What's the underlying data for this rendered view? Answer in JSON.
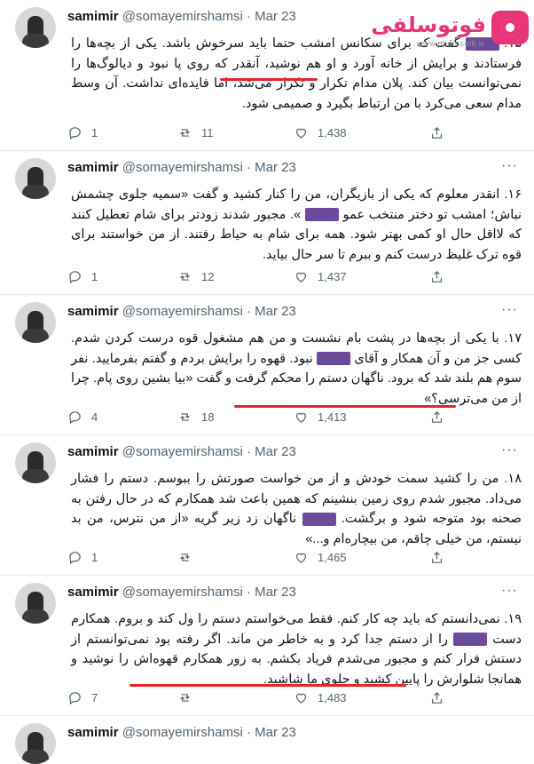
{
  "watermark": {
    "brand": "فوتوسلفی",
    "url": "www.photoselfi.ir"
  },
  "tweets": [
    {
      "name": "samimir",
      "handle": "@somayemirshamsi",
      "date": "Mar 23",
      "text_before": "۱۵.",
      "text": "گفت که برای سکانس امشب حتما باید سرخوش باشد. یکی از بچه‌ها را فرستادند و برایش از خانه آورد و او هم نوشید، آنقدر که روی پا نبود و دیالوگ‌ها را نمی‌توانست بیان کند. پلان مدام تکرار و تکرار می‌شد، اما فایده‌ای نداشت. آن وسط مدام سعی می‌کرد با من ارتباط بگیرد و صمیمی شود.",
      "replies": "1",
      "retweets": "11",
      "likes": "1,438"
    },
    {
      "name": "samimir",
      "handle": "@somayemirshamsi",
      "date": "Mar 23",
      "text_before": "۱۶. انقدر معلوم که یکی از بازیگران، من را کنار کشید و گفت «سمیه جلوی چشمش نباش؛ امشب تو دختر منتخب عمو",
      "text": "». مجبور شدند زودتر برای شام تعطیل کنند که لااقل حال او کمی بهتر شود. همه برای شام به حیاط رفتند. از من خواستند برای قوه ترک غلیظ درست کنم و ببرم تا سر حال بیاید.",
      "replies": "1",
      "retweets": "12",
      "likes": "1,437"
    },
    {
      "name": "samimir",
      "handle": "@somayemirshamsi",
      "date": "Mar 23",
      "text_before": "۱۷. با یکی از بچه‌ها در پشت بام نشست و من هم مشغول قوه درست کردن شدم. کسی جز من و آن همکار و آقای",
      "text": "نبود. قهوه را برایش بردم و گفتم بفرمایید. نفر سوم هم بلند شد که برود. ناگهان دستم را محکم گرفت و گفت «بیا بشین روی پام. چرا از من می‌ترسی؟»",
      "replies": "4",
      "retweets": "18",
      "likes": "1,413"
    },
    {
      "name": "samimir",
      "handle": "@somayemirshamsi",
      "date": "Mar 23",
      "text_before": "۱۸. من را کشید سمت خودش و از من خواست صورتش را ببوسم. دستم را فشار می‌داد. مجبور شدم روی زمین بنشینم که همین باعث شد همکارم که در حال رفتن به صحنه بود متوجه شود و برگشت.",
      "text": "ناگهان زد زیر گریه «از من نترس، من بد نیستم، من خیلی چاقم، من بیچاره‌ام و...»",
      "replies": "1",
      "retweets": "",
      "likes": "1,465"
    },
    {
      "name": "samimir",
      "handle": "@somayemirshamsi",
      "date": "Mar 23",
      "text_before": "۱۹. نمی‌دانستم که باید چه کار کنم. فقط می‌خواستم دستم را ول کند و بروم. همکارم دست",
      "text": "را از دستم جدا کرد و به خاطر من ماند. اگر رفته بود نمی‌توانستم از دستش فرار کنم و مجبور می‌شدم فریاد بکشم. به زور همکارم قهوه‌اش را نوشید و همانجا شلوارش را پایین کشید و جلوی ما شاشید.",
      "replies": "7",
      "retweets": "",
      "likes": "1,483"
    },
    {
      "name": "samimir",
      "handle": "@somayemirshamsi",
      "date": "Mar 23"
    }
  ]
}
